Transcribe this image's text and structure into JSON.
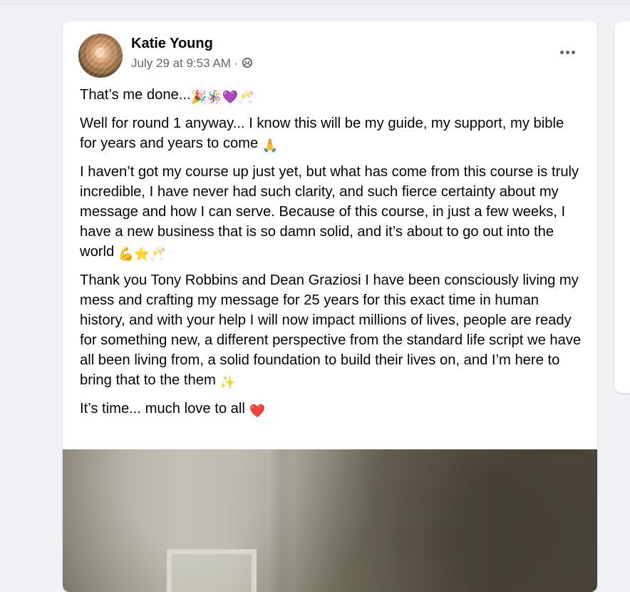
{
  "post": {
    "author": {
      "name": "Katie Young",
      "avatar": "profile-photo"
    },
    "meta": {
      "timestamp": "July 29 at 9:53 AM",
      "separator": "·",
      "audience_icon": "friends-icon"
    },
    "actions": {
      "more_icon": "more-options-icon"
    },
    "paragraphs": [
      "That’s me done...",
      "Well for round 1 anyway... I know this will be my guide, my support, my bible for years and years to come",
      "I haven’t got my course up just yet, but what has come from this course is truly incredible, I have never had such clarity, and such fierce certainty about my message and how I can serve. Because of this course, in just a few weeks, I have a new business that is so damn solid, and it’s about to go out into the world",
      "Thank you Tony Robbins and Dean Graziosi I have been consciously living my mess and crafting my message for 25 years for this exact time in human history, and with your help I will now impact millions of lives, people are ready for something new, a different perspective from the standard life script we have all been living from, a solid foundation to build their lives on, and I’m here to bring that to the them",
      "It’s time... much love to all"
    ],
    "emojis": {
      "p1": [
        "🎉",
        "🪅",
        "💜",
        "🥂"
      ],
      "p2": [
        "🙏"
      ],
      "p3": [
        "💪",
        "⭐",
        "🥂"
      ],
      "p4": [
        "✨"
      ],
      "p5": [
        "❤️"
      ]
    },
    "media": {
      "type": "photo"
    }
  },
  "colors": {
    "background": "#f0f2f5",
    "card": "#ffffff",
    "primary_text": "#050505",
    "secondary_text": "#65676b"
  }
}
